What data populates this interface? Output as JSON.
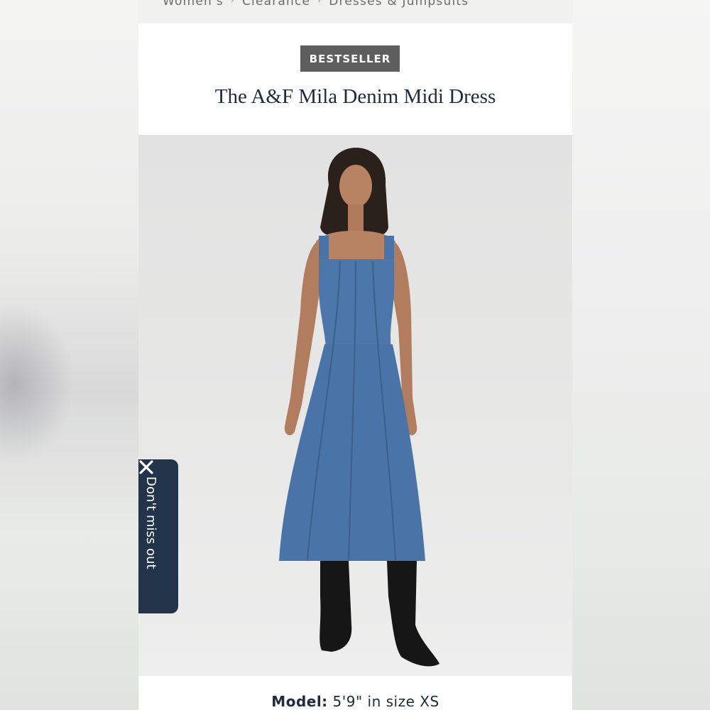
{
  "breadcrumb": {
    "items": [
      "Women's",
      "Clearance",
      "Dresses & Jumpsuits"
    ]
  },
  "product": {
    "badge": "BESTSELLER",
    "title": "The A&F Mila Denim Midi Dress",
    "model_label": "Model:",
    "model_value": "5'9\" in size XS"
  },
  "promo_tab": {
    "label": "Don't miss out"
  },
  "colors": {
    "navy": "#22344a",
    "badge_bg": "#5e5e5e",
    "denim": "#4a74a8"
  },
  "icons": {
    "crumb_separator": "chevron-right-icon",
    "close": "close-icon"
  }
}
